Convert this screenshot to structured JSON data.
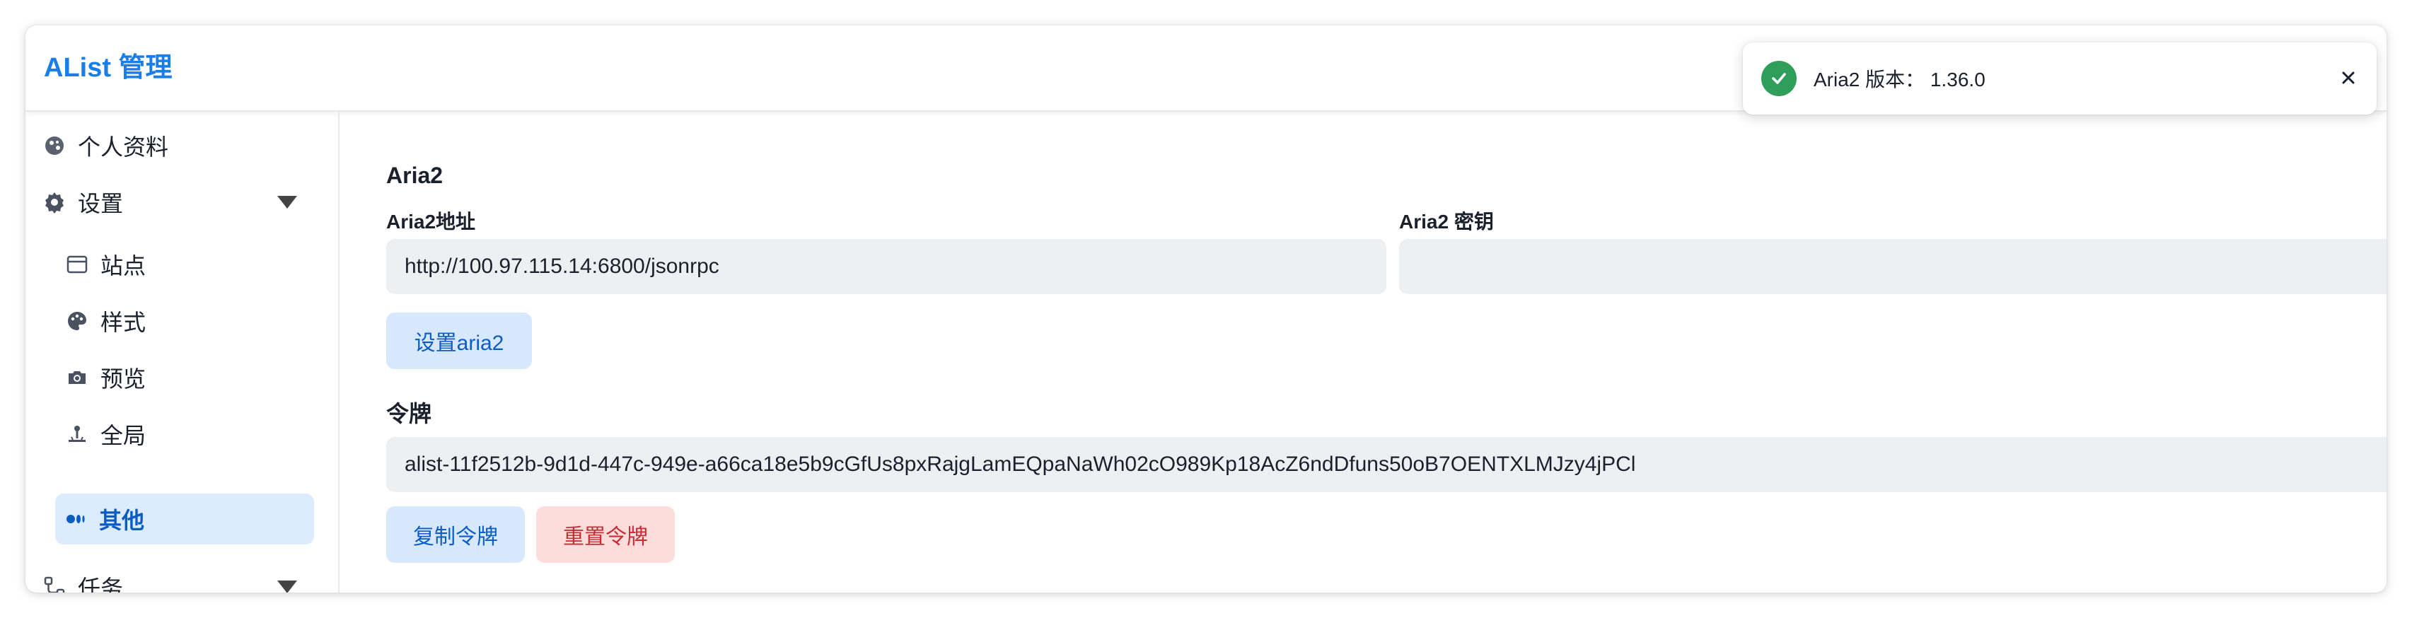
{
  "header": {
    "title": "AList 管理"
  },
  "sidebar": {
    "items": [
      {
        "label": "个人资料",
        "icon": "profile-icon"
      },
      {
        "label": "设置",
        "icon": "gear-icon",
        "expanded": true
      },
      {
        "label": "站点",
        "icon": "site-icon"
      },
      {
        "label": "样式",
        "icon": "palette-icon"
      },
      {
        "label": "预览",
        "icon": "camera-icon"
      },
      {
        "label": "全局",
        "icon": "joystick-icon"
      },
      {
        "label": "其他",
        "icon": "other-icon",
        "active": true
      },
      {
        "label": "任务",
        "icon": "tasks-icon",
        "expanded": false
      }
    ]
  },
  "main": {
    "aria2": {
      "title": "Aria2",
      "url_label": "Aria2地址",
      "url_value": "http://100.97.115.14:6800/jsonrpc",
      "secret_label": "Aria2 密钥",
      "secret_value": "",
      "set_button": "设置aria2"
    },
    "token": {
      "title": "令牌",
      "value": "alist-11f2512b-9d1d-447c-949e-a66ca18e5b9cGfUs8pxRajgLamEQpaNaWh02cO989Kp18AcZ6ndDfuns50oB7OENTXLMJzy4jPCl",
      "copy_button": "复制令牌",
      "reset_button": "重置令牌"
    }
  },
  "toast": {
    "message": "Aria2 版本： 1.36.0",
    "status": "success",
    "colors": {
      "success": "#2f9e5b"
    }
  },
  "colors": {
    "brand": "#1a7ee8",
    "active_bg": "#dcebfd",
    "danger": "#c62d35"
  }
}
